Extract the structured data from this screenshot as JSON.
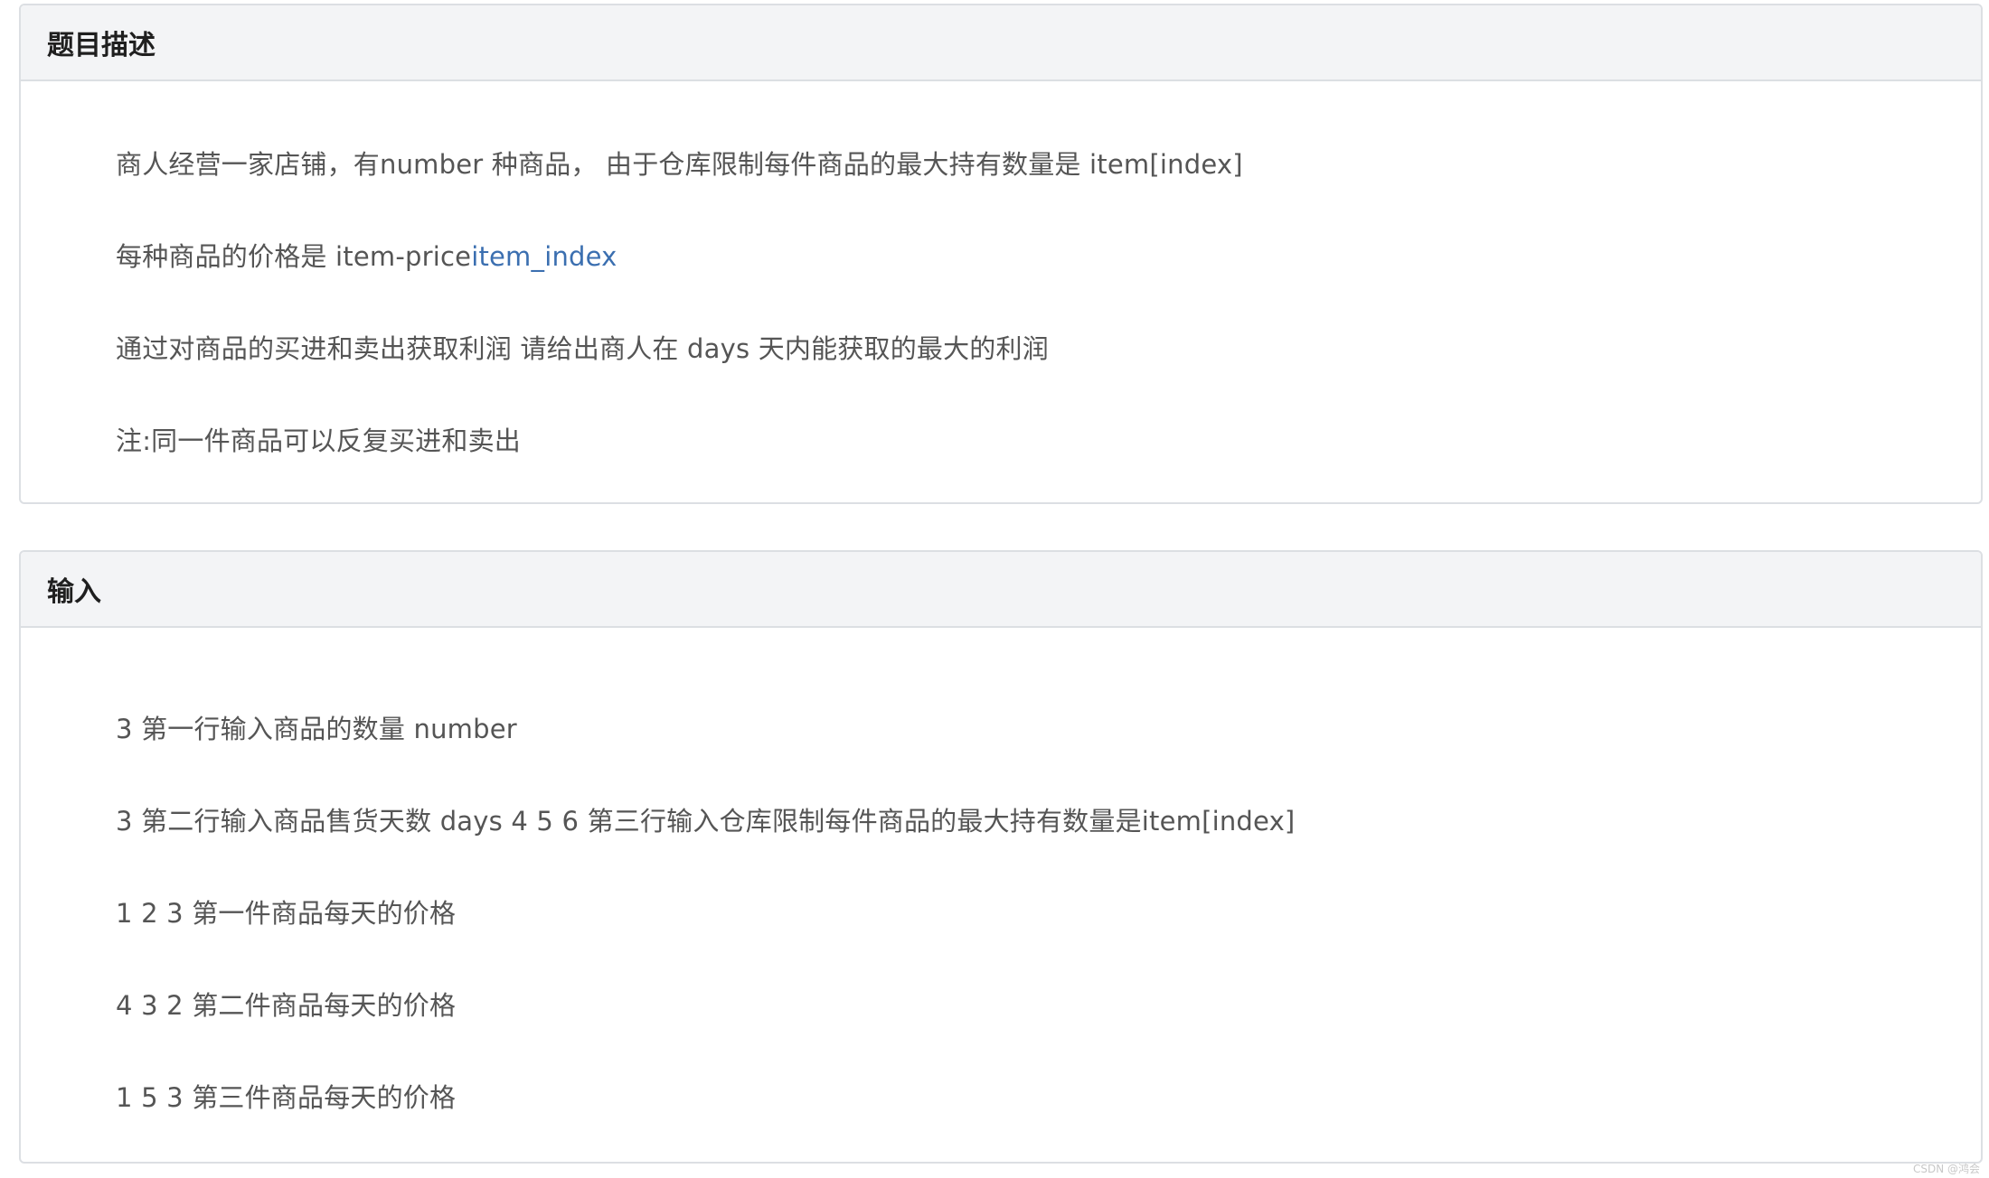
{
  "description_panel": {
    "header": "题目描述",
    "lines": [
      "商人经营一家店铺，有number 种商品， 由于仓库限制每件商品的最大持有数量是 item[index]",
      "通过对商品的买进和卖出获取利润 请给出商人在 days 天内能获取的最大的利润",
      "注:同一件商品可以反复买进和卖出"
    ],
    "price_line_prefix": "每种商品的价格是 item-price",
    "price_line_link": "item_index"
  },
  "input_panel": {
    "header": "输入",
    "lines": [
      "3 第一行输入商品的数量 number",
      "3 第二行输入商品售货天数 days 4 5 6 第三行输入仓库限制每件商品的最大持有数量是item[index]",
      "1 2 3 第一件商品每天的价格",
      "4 3 2 第二件商品每天的价格",
      "1 5 3 第三件商品每天的价格"
    ]
  },
  "watermark": "CSDN @鸿会",
  "colors": {
    "header_bg": "#f3f4f6",
    "border": "#dcdfe3",
    "body_text": "#555555",
    "link": "#3b6fb0"
  }
}
